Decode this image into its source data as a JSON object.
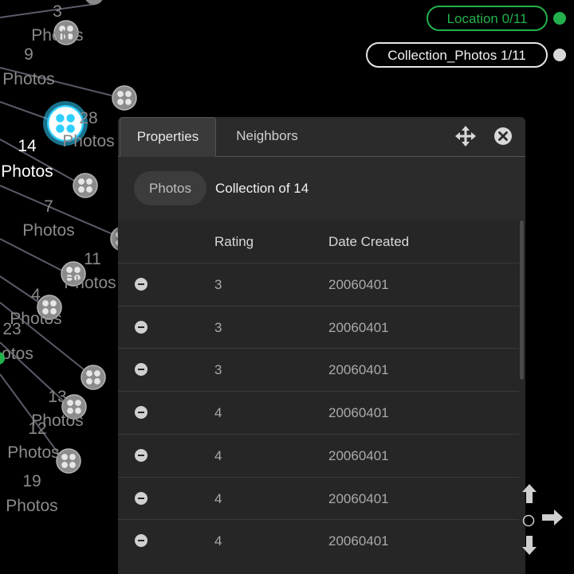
{
  "graph": {
    "nodes": [
      {
        "id": "n3",
        "count": "3",
        "unit": "Photos"
      },
      {
        "id": "n9",
        "count": "9",
        "unit": "Photos"
      },
      {
        "id": "n28",
        "count": "28",
        "unit": "Photos"
      },
      {
        "id": "n14",
        "count": "14",
        "unit": "Photos",
        "selected": true
      },
      {
        "id": "n7",
        "count": "7",
        "unit": "Photos"
      },
      {
        "id": "n11",
        "count": "11",
        "unit": "Photos"
      },
      {
        "id": "n4",
        "count": "4",
        "unit": "Photos"
      },
      {
        "id": "n23",
        "count": "23",
        "unit": "otos"
      },
      {
        "id": "n13",
        "count": "13",
        "unit": "Photos"
      },
      {
        "id": "n12",
        "count": "12",
        "unit": "Photos"
      },
      {
        "id": "n19",
        "count": "19",
        "unit": "Photos"
      }
    ]
  },
  "legend": {
    "location": {
      "label": "Location 0/11",
      "color": "#22b14c"
    },
    "collection": {
      "label": "Collection_Photos 1/11",
      "color": "#d9d9d9"
    }
  },
  "panel": {
    "tabs": [
      {
        "label": "Properties",
        "active": true
      },
      {
        "label": "Neighbors",
        "active": false
      }
    ],
    "type_label": "Photos",
    "collection_text": "Collection of 14",
    "columns": [
      "Rating",
      "Date Created"
    ],
    "rows": [
      {
        "rating": "3",
        "date": "20060401"
      },
      {
        "rating": "3",
        "date": "20060401"
      },
      {
        "rating": "3",
        "date": "20060401"
      },
      {
        "rating": "4",
        "date": "20060401"
      },
      {
        "rating": "4",
        "date": "20060401"
      },
      {
        "rating": "4",
        "date": "20060401"
      },
      {
        "rating": "4",
        "date": "20060401"
      }
    ]
  },
  "icons": {
    "move": "move-icon",
    "close": "close-icon",
    "remove": "minus-circle-icon",
    "nav": [
      "arrow-up-icon",
      "arrow-right-icon",
      "arrow-down-icon"
    ]
  }
}
